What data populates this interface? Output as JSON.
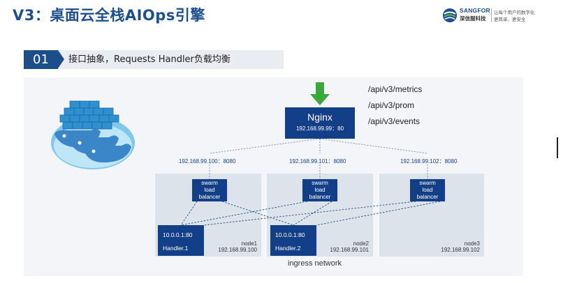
{
  "slide": {
    "title": "V3：桌面云全栈AIOps引擎"
  },
  "logo": {
    "brand": "SANGFOR",
    "brand_cn": "深信服科技",
    "tagline_1": "让每个用户的数字化",
    "tagline_2": "更简单、更安全"
  },
  "section": {
    "number": "01",
    "title": "接口抽象，Requests Handler负载均衡"
  },
  "diagram": {
    "nginx": {
      "name": "Nginx",
      "ip": "192.168.99.99：80"
    },
    "endpoints": [
      "/api/v3/metrics",
      "/api/v3/prom",
      "/api/v3/events"
    ],
    "swarm_ports": [
      "192.168.99.100：8080",
      "192.168.99.101：8080",
      "192.168.99.102：8080"
    ],
    "swarm_label": [
      "swarm",
      "load",
      "balancer"
    ],
    "handlers": [
      {
        "ip": "10.0.0.1:80",
        "name": "Handler.1"
      },
      {
        "ip": "10.0.0.1:80",
        "name": "Handler.2"
      }
    ],
    "nodes": [
      {
        "name": "node1",
        "ip": "192.168.99.100"
      },
      {
        "name": "node2",
        "ip": "192.168.99.101"
      },
      {
        "name": "node3",
        "ip": "192.168.99.102"
      }
    ],
    "network_label": "ingress network"
  },
  "colors": {
    "title": "#1d4f8e",
    "box": "#123f87",
    "arrow": "#3aa83a",
    "node_bg": "#dde3ea",
    "panel_bg": "#f3f5f8"
  }
}
